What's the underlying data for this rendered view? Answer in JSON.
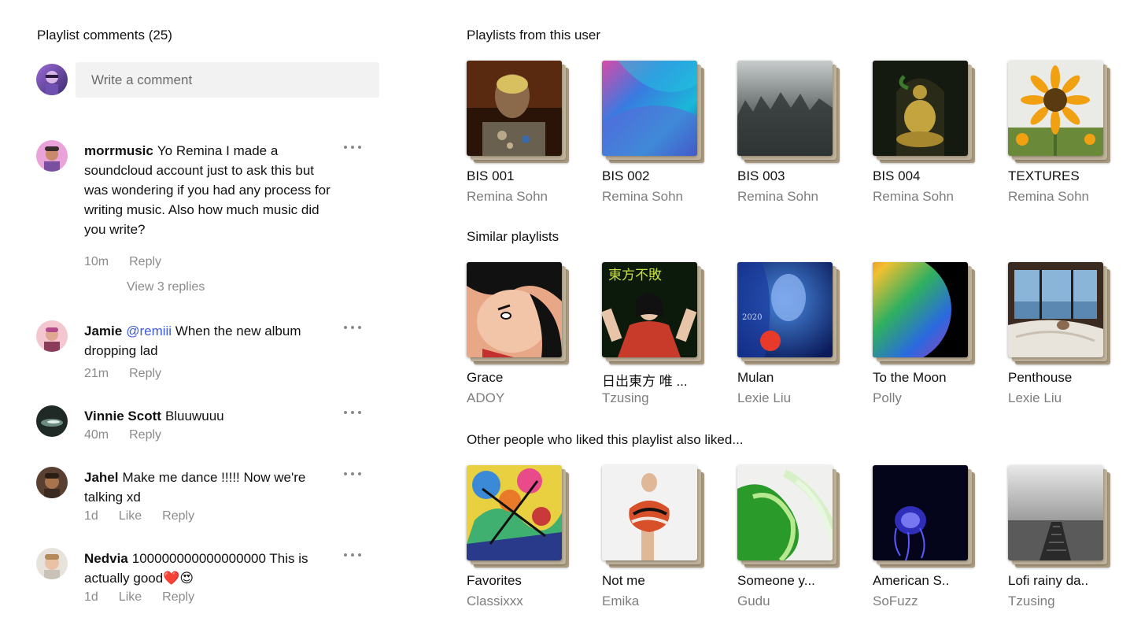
{
  "comments_section": {
    "title": "Playlist comments (25)",
    "input_placeholder": "Write a comment",
    "comments": [
      {
        "author": "morrmusic",
        "text": "Yo Remina I made a soundcloud account just to ask this but was wondering if you had any process for writing music. Also how much music did you write?",
        "time": "10m",
        "actions": [
          "Reply"
        ],
        "view_replies": "View 3 replies"
      },
      {
        "author": "Jamie",
        "mention": "@remiii",
        "text": " When the new album dropping lad",
        "time": "21m",
        "actions": [
          "Reply"
        ]
      },
      {
        "author": "Vinnie Scott",
        "text": "Bluuwuuu",
        "time": "40m",
        "actions": [
          "Reply"
        ]
      },
      {
        "author": "Jahel",
        "text": "Make me dance !!!!! Now we're talking xd",
        "time": "1d",
        "actions": [
          "Like",
          "Reply"
        ]
      },
      {
        "author": "Nedvia",
        "text": "100000000000000000 This is actually good❤️😍",
        "time": "1d",
        "actions": [
          "Like",
          "Reply"
        ]
      }
    ]
  },
  "playlist_sections": [
    {
      "title": "Playlists from this user",
      "items": [
        {
          "title": "BIS 001",
          "artist": "Remina Sohn"
        },
        {
          "title": "BIS 002",
          "artist": "Remina Sohn"
        },
        {
          "title": "BIS 003",
          "artist": "Remina Sohn"
        },
        {
          "title": "BIS 004",
          "artist": "Remina Sohn"
        },
        {
          "title": "TEXTURES",
          "artist": "Remina Sohn"
        }
      ]
    },
    {
      "title": "Similar playlists",
      "items": [
        {
          "title": "Grace",
          "artist": "ADOY"
        },
        {
          "title": "日出東方 唯 ...",
          "artist": "Tzusing"
        },
        {
          "title": "Mulan",
          "artist": "Lexie Liu"
        },
        {
          "title": "To the Moon",
          "artist": "Polly"
        },
        {
          "title": "Penthouse",
          "artist": "Lexie Liu"
        }
      ]
    },
    {
      "title": "Other people who liked this playlist also liked...",
      "items": [
        {
          "title": "Favorites",
          "artist": "Classixxx"
        },
        {
          "title": "Not me",
          "artist": "Emika"
        },
        {
          "title": "Someone y...",
          "artist": "Gudu"
        },
        {
          "title": "American S..",
          "artist": "SoFuzz"
        },
        {
          "title": "Lofi rainy da..",
          "artist": "Tzusing"
        }
      ]
    }
  ],
  "cover_text": {
    "grace_cover_kanji": "東方不敗",
    "mulan_cover_year": "2020"
  },
  "colors": {
    "mention": "#3b5bdb",
    "muted_text": "#8b8b8b",
    "stack_back": "#a8997f",
    "input_bg": "#f2f2f2"
  }
}
